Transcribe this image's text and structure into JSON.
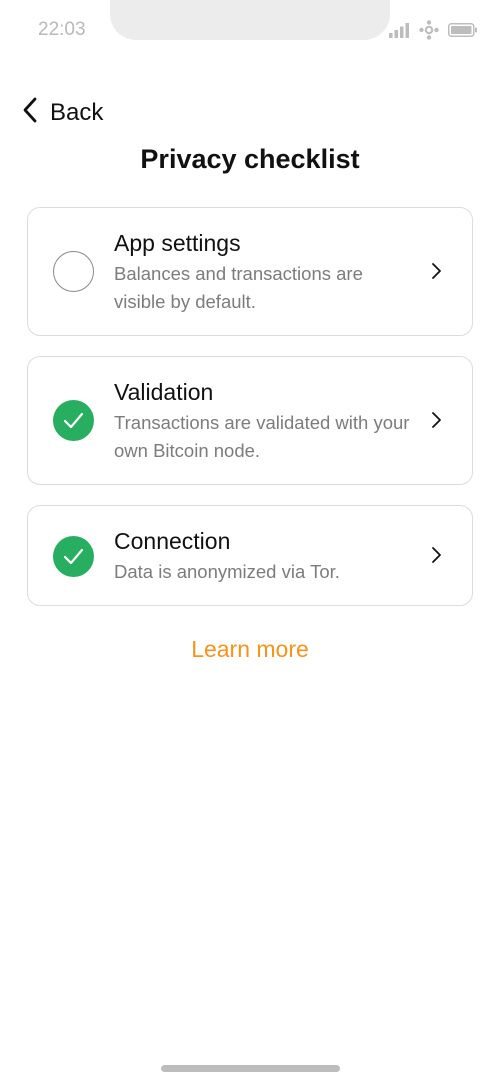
{
  "status_bar": {
    "time": "22:03"
  },
  "header": {
    "back_label": "Back",
    "title": "Privacy checklist"
  },
  "checklist": [
    {
      "title": "App settings",
      "description": "Balances and transactions are visible by default.",
      "completed": false
    },
    {
      "title": "Validation",
      "description": "Transactions are validated with your own Bitcoin node.",
      "completed": true
    },
    {
      "title": "Connection",
      "description": "Data is anonymized via Tor.",
      "completed": true
    }
  ],
  "learn_more_label": "Learn more",
  "colors": {
    "accent": "#f7931a",
    "success": "#27ae60",
    "muted_text": "#7c7c7c"
  },
  "icons": {
    "signal": "signal-bars-icon",
    "network": "network-icon",
    "battery": "battery-icon",
    "back": "chevron-left-icon",
    "check": "checkmark-icon",
    "chevron": "chevron-right-icon"
  }
}
